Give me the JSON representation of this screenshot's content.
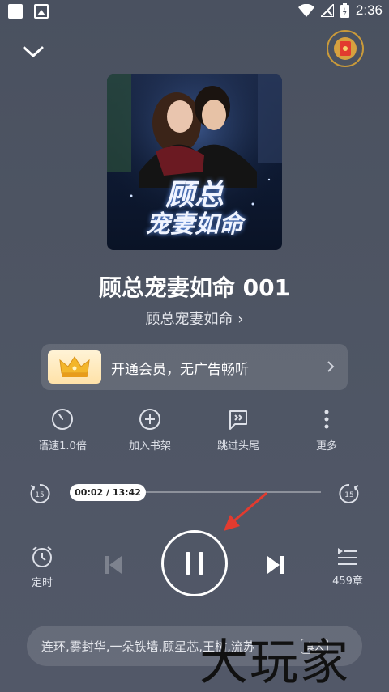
{
  "status_bar": {
    "time": "2:36"
  },
  "book": {
    "cover_line1": "顾总",
    "cover_line2": "宠妻如命",
    "episode_title": "顾总宠妻如命 001",
    "book_name": "顾总宠妻如命",
    "book_link_suffix": "›"
  },
  "vip_banner": {
    "text": "开通会员，无广告畅听"
  },
  "actions": [
    {
      "label": "语速1.0倍",
      "icon": "speed-gauge-icon"
    },
    {
      "label": "加入书架",
      "icon": "add-circle-icon"
    },
    {
      "label": "跳过头尾",
      "icon": "skip-intro-icon"
    },
    {
      "label": "更多",
      "icon": "more-vertical-icon"
    }
  ],
  "player": {
    "time_display": "00:02 / 13:42",
    "progress": 0.0024,
    "skip_back_seconds": "15",
    "skip_forward_seconds": "15",
    "timer_label": "定时",
    "chapters_label": "459章"
  },
  "cast": {
    "text": "连环,雾封华,一朵铁墙,顾星芯,王树,流苏",
    "tag": "真人"
  },
  "watermark": "大玩家",
  "colors": {
    "accent_gold": "#d6a13f",
    "red_envelope": "#e23b2f",
    "pointer": "#e23b2f"
  }
}
